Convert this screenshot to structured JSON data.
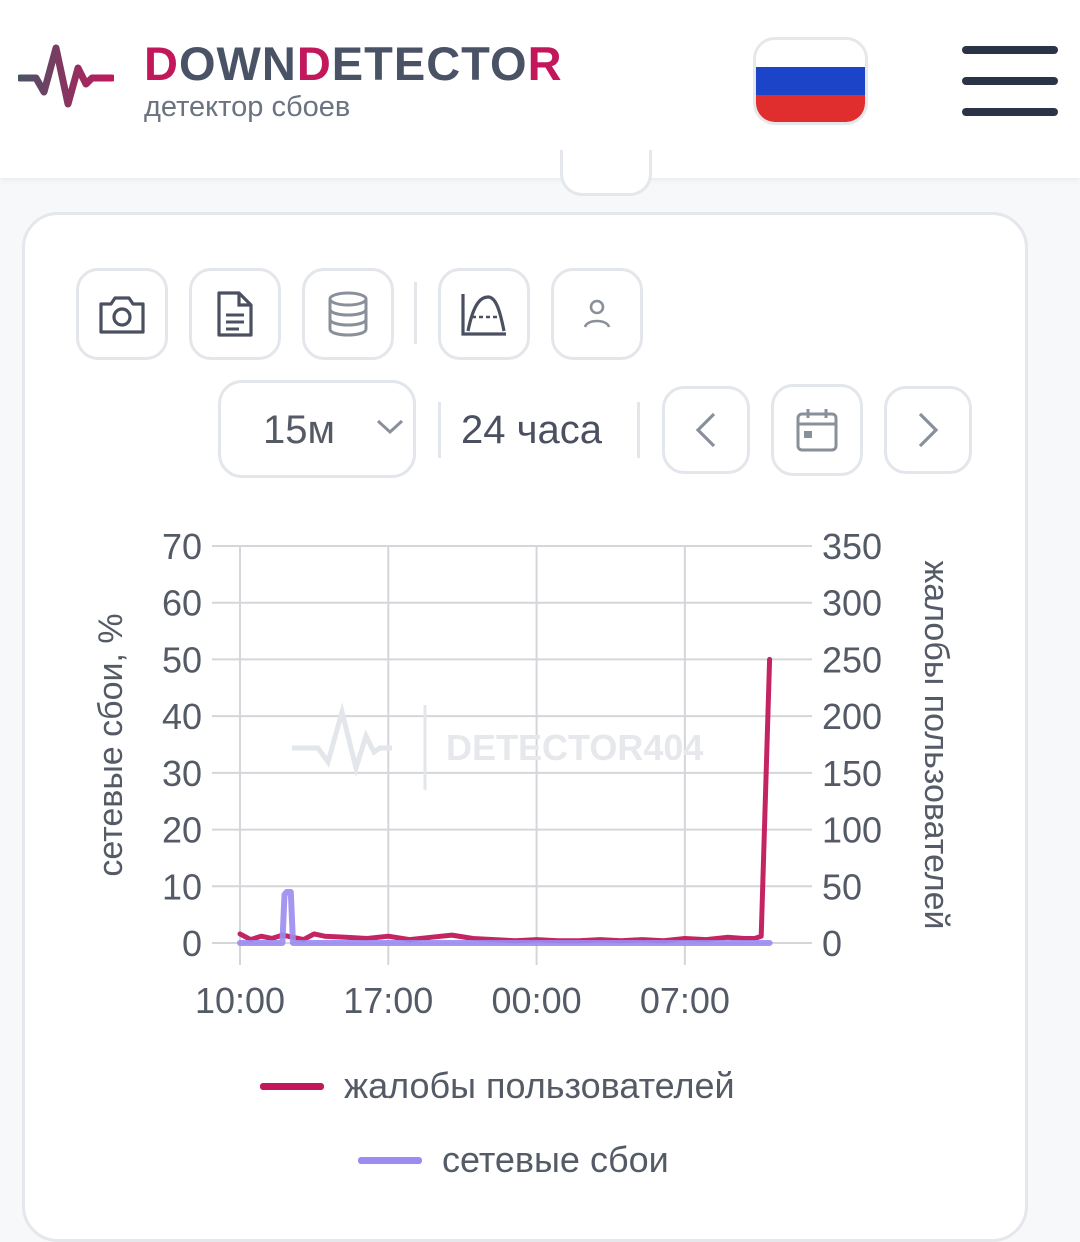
{
  "header": {
    "brand_part1": "DOWN",
    "brand_part2": "DETECTOR",
    "tagline": "детектор сбоев",
    "accent_color": "#c2185b",
    "brand_text_color": "#4a5366",
    "country_flag": "russia-flag-icon",
    "menu_icon": "hamburger-menu-icon"
  },
  "toolbar": {
    "icons": [
      "camera-icon",
      "document-icon",
      "database-icon",
      "chart-curve-icon",
      "user-icon"
    ]
  },
  "controls": {
    "interval_value": "15м",
    "range_label": "24 часа",
    "icons": [
      "chevron-left-icon",
      "calendar-icon",
      "chevron-right-icon"
    ]
  },
  "chart_data": {
    "type": "line",
    "watermark": "DETECTOR404",
    "left_axis": {
      "label": "сетевые сбои, %",
      "ylim": [
        0,
        70
      ],
      "ticks": [
        "70",
        "60",
        "50",
        "40",
        "30",
        "20",
        "10",
        "0"
      ]
    },
    "right_axis": {
      "label": "жалобы пользователей",
      "ylim": [
        0,
        350
      ],
      "ticks": [
        "350",
        "300",
        "250",
        "200",
        "150",
        "100",
        "50",
        "0"
      ]
    },
    "x_tick_labels": [
      "10:00",
      "17:00",
      "00:00",
      "07:00"
    ],
    "x_ticks_hours": [
      0,
      7,
      14,
      21
    ],
    "x_range_hours": [
      0,
      27
    ],
    "grid": true,
    "legend_position": "bottom",
    "series": [
      {
        "name": "жалобы пользователей",
        "axis": "right",
        "color": "#c2185b",
        "x_hours": [
          0,
          0.5,
          1,
          1.5,
          2,
          2.5,
          3,
          3.5,
          4,
          5,
          6,
          7,
          8,
          9,
          10,
          11,
          12,
          13,
          14,
          15,
          16,
          17,
          18,
          19,
          20,
          21,
          22,
          23,
          23.8,
          24.3,
          24.6,
          24.85,
          25.0
        ],
        "values": [
          8,
          3,
          6,
          4,
          7,
          5,
          3,
          8,
          6,
          5,
          4,
          6,
          3,
          5,
          7,
          4,
          3,
          2,
          3,
          2,
          2,
          3,
          2,
          3,
          2,
          4,
          3,
          5,
          4,
          4,
          6,
          160,
          250
        ]
      },
      {
        "name": "сетевые сбои",
        "axis": "left",
        "color": "#9a8cf0",
        "x_hours": [
          0,
          1.5,
          2.0,
          2.1,
          2.2,
          2.4,
          2.5,
          3.0,
          10,
          20,
          24.9,
          25.0
        ],
        "values": [
          0,
          0,
          0,
          8.5,
          9,
          9,
          0,
          0,
          0,
          0,
          0,
          0
        ]
      }
    ]
  }
}
